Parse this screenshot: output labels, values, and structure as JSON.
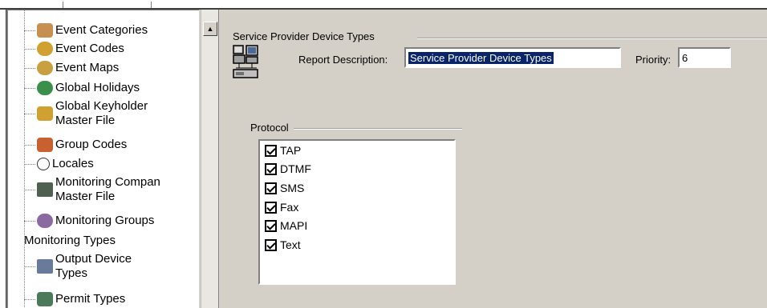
{
  "tree": {
    "items": [
      {
        "label": "Event Categories",
        "icon": "event-categories-icon",
        "color": "#c89050"
      },
      {
        "label": "Event Codes",
        "icon": "event-codes-icon",
        "color": "#d0a030"
      },
      {
        "label": "Event Maps",
        "icon": "event-maps-icon",
        "color": "#c8a040"
      },
      {
        "label": "Global Holidays",
        "icon": "globe-icon",
        "color": "#3a8f4a"
      },
      {
        "label": "Global Keyholder",
        "label2": "Master File",
        "icon": "keyholder-icon",
        "color": "#d0a030"
      },
      {
        "label": "Group Codes",
        "icon": "group-codes-icon",
        "color": "#c86030"
      },
      {
        "label": "Locales",
        "icon": "locales-icon",
        "color": "#ffffff"
      },
      {
        "label": "Monitoring Compan",
        "label2": "Master File",
        "icon": "monitoring-company-icon",
        "color": "#506050"
      },
      {
        "label": "Monitoring Groups",
        "icon": "monitoring-groups-icon",
        "color": "#8a6aa0"
      },
      {
        "label": "Monitoring Types",
        "icon": "",
        "color": ""
      },
      {
        "label": "Output Device",
        "label2": "Types",
        "icon": "output-device-icon",
        "color": "#6a7a9a"
      },
      {
        "label": "Permit Types",
        "icon": "permit-types-icon",
        "color": "#4a7a5a"
      }
    ]
  },
  "details": {
    "group_title": "Service Provider Device Types",
    "report_description_label": "Report Description:",
    "report_description_value": "Service Provider Device Types",
    "priority_label": "Priority:",
    "priority_value": "6"
  },
  "protocol": {
    "group_title": "Protocol",
    "options": [
      {
        "label": "TAP",
        "checked": true
      },
      {
        "label": "DTMF",
        "checked": true
      },
      {
        "label": "SMS",
        "checked": true
      },
      {
        "label": "Fax",
        "checked": true
      },
      {
        "label": "MAPI",
        "checked": true
      },
      {
        "label": "Text",
        "checked": true
      }
    ]
  },
  "scrollbar": {
    "up_arrow": "▲"
  }
}
